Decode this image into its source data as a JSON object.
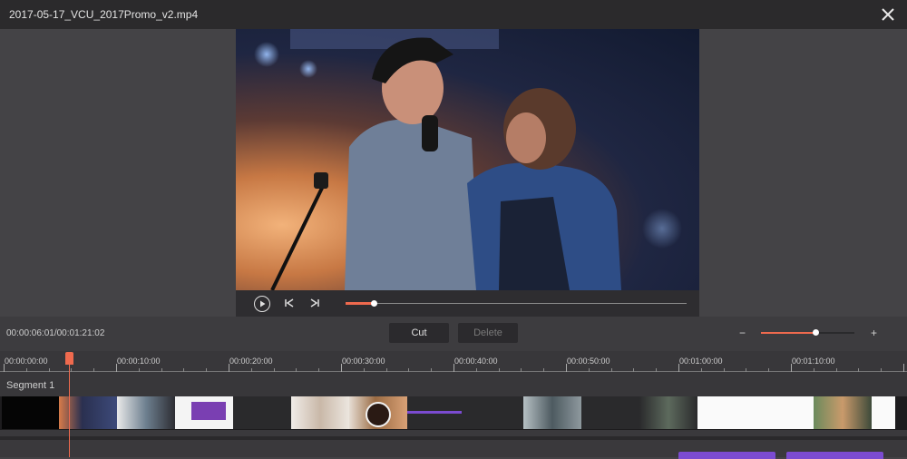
{
  "window": {
    "title": "2017-05-17_VCU_2017Promo_v2.mp4"
  },
  "player": {
    "progress_fraction": 0.083
  },
  "toolbar": {
    "timecode": "00:00:06:01/00:01:21:02",
    "cut_label": "Cut",
    "delete_label": "Delete",
    "zoom_minus": "−",
    "zoom_plus": "+",
    "zoom_fraction": 0.58
  },
  "ruler": {
    "labels": [
      "00:00:00:00",
      "00:00:10:00",
      "00:00:20:00",
      "00:00:30:00",
      "00:00:40:00",
      "00:00:50:00",
      "00:01:00:00",
      "00:01:10:00"
    ]
  },
  "timeline": {
    "segment_label": "Segment 1"
  },
  "colors": {
    "accent": "#ef6a4e",
    "button_purple": "#7b4bd1"
  },
  "icons": {
    "close": "close-icon",
    "play": "play-icon",
    "prev": "skip-back-icon",
    "next": "skip-forward-icon"
  }
}
